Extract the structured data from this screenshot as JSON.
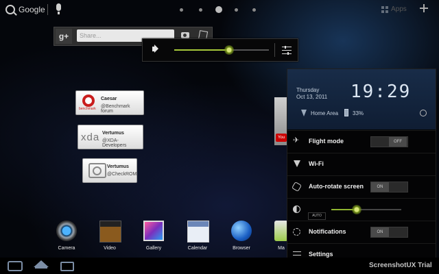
{
  "topbar": {
    "search_label": "Google",
    "apps_label": "Apps",
    "page_dots": 5,
    "active_page": 3
  },
  "gplus_widget": {
    "logo": "g+",
    "share_placeholder": "Share..."
  },
  "volume_popup": {
    "level": 0.58
  },
  "widgets": [
    {
      "title": "Caesar",
      "subtitle": "@Benchmark forum",
      "logo_text": "benchmark"
    },
    {
      "title": "Vertumus",
      "subtitle": "@XDA-Developers",
      "logo_text": "xda"
    },
    {
      "title": "Vertumus",
      "subtitle": "@CheckROM"
    }
  ],
  "quick_settings": {
    "day": "Thursday",
    "date": "Oct 13, 2011",
    "time": "19:29",
    "network": "Home Area",
    "battery": "33%",
    "rows": {
      "flight_mode": {
        "label": "Flight mode",
        "state": "OFF"
      },
      "wifi": {
        "label": "Wi-Fi"
      },
      "auto_rotate": {
        "label": "Auto-rotate screen",
        "state": "ON"
      },
      "brightness": {
        "auto_label": "AUTO",
        "level": 0.36
      },
      "notifications": {
        "label": "Notifications",
        "state": "ON"
      },
      "settings": {
        "label": "Settings"
      }
    }
  },
  "dock": {
    "items": [
      "Camera",
      "Video",
      "Gallery",
      "Calendar",
      "Browser",
      "Market"
    ],
    "partial_label": "Ma"
  },
  "navbar": {
    "trial_label": "ScreenshotUX Trial"
  },
  "colors": {
    "slider_accent": "#a7c93a",
    "panel_header": "#182c48",
    "nav_icons": "#7c8ea6"
  }
}
